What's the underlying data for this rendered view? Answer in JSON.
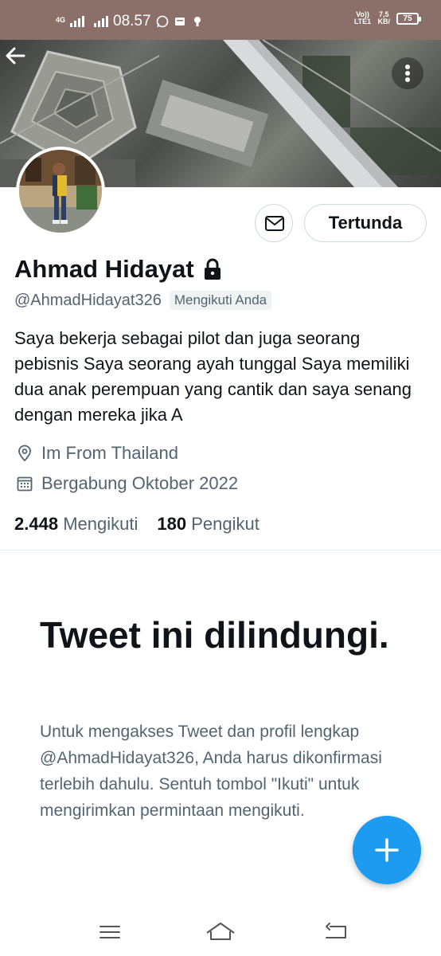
{
  "status_bar": {
    "network": "4G",
    "time": "08.57",
    "volte": "Vo)) LTE1",
    "speed_value": "7,5",
    "speed_unit": "KB/",
    "battery": "75"
  },
  "header": {
    "back_icon": "arrow-left-icon",
    "more_icon": "more-vertical-icon"
  },
  "profile": {
    "display_name": "Ahmad Hidayat",
    "lock_icon": "lock-icon",
    "handle": "@AhmadHidayat326",
    "follows_you_label": "Mengikuti Anda",
    "bio": "Saya bekerja sebagai pilot dan juga seorang pebisnis Saya seorang ayah tunggal Saya memiliki dua anak perempuan yang cantik dan saya senang dengan mereka jika A",
    "location": "Im From Thailand",
    "joined": "Bergabung Oktober 2022",
    "following_count": "2.448",
    "following_label": "Mengikuti",
    "followers_count": "180",
    "followers_label": "Pengikut"
  },
  "actions": {
    "message_icon": "envelope-icon",
    "pending_label": "Tertunda"
  },
  "protected": {
    "title": "Tweet ini dilindungi.",
    "body": "Untuk mengakses Tweet dan profil lengkap @AhmadHidayat326, Anda harus dikonfirmasi terlebih dahulu. Sentuh tombol \"Ikuti\" untuk mengirimkan permintaan mengikuti."
  },
  "fab": {
    "icon": "plus-icon"
  },
  "navbar": {
    "menu_icon": "menu-icon",
    "home_icon": "home-icon",
    "back_icon": "back-icon"
  },
  "colors": {
    "accent": "#1d9bf0",
    "status_bar": "#8a7069",
    "text_primary": "#0f1419",
    "text_secondary": "#536471"
  }
}
